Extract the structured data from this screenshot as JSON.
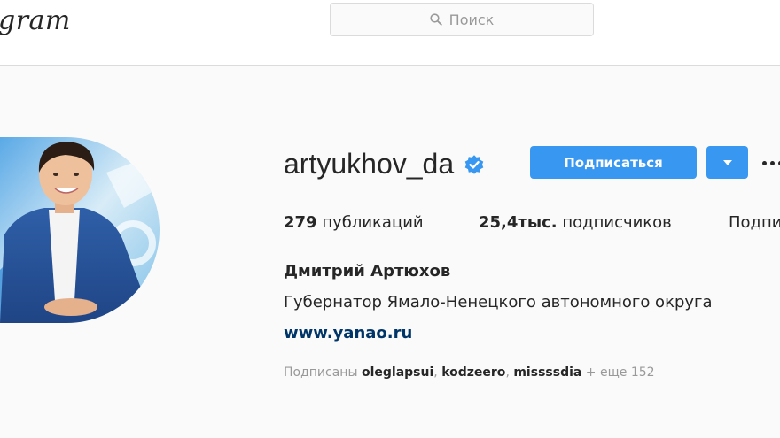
{
  "header": {
    "logo_text": "gram",
    "search_placeholder": "Поиск"
  },
  "profile": {
    "username": "artyukhov_da",
    "verified": true,
    "follow_label": "Подписаться",
    "stats": {
      "posts_value": "279",
      "posts_label": "публикаций",
      "followers_value": "25,4тыс.",
      "followers_label": "подписчиков",
      "following_label": "Подпи"
    },
    "full_name": "Дмитрий Артюхов",
    "bio": "Губернатор Ямало-Ненецкого автономного округа",
    "website": "www.yanao.ru",
    "followed_by": {
      "prefix": "Подписаны",
      "user1": "oleglapsui",
      "user2": "kodzeero",
      "user3": "missssdia",
      "more": "+ еще 152"
    }
  },
  "colors": {
    "accent": "#3897f0",
    "link": "#003569",
    "muted": "#999999",
    "text": "#262626"
  }
}
